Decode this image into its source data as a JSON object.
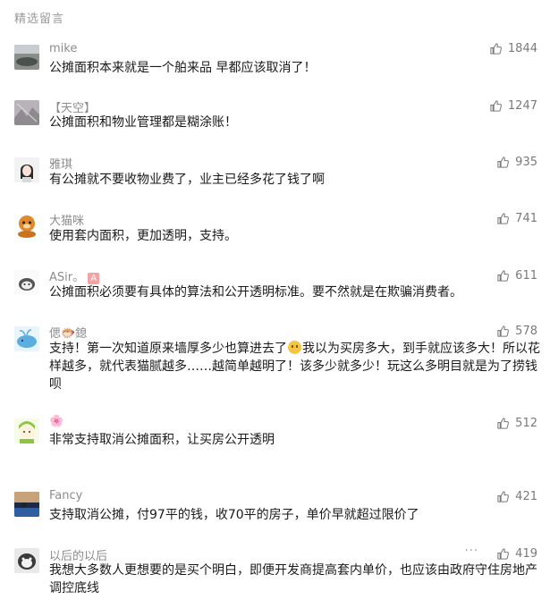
{
  "section": {
    "title": "精选留言"
  },
  "comments": [
    {
      "nickname": "mike",
      "likes": "1844",
      "text": "公摊面积本来就是一个舶来品 早都应该取消了！"
    },
    {
      "nickname": "【天空】",
      "likes": "1247",
      "text": "公摊面积和物业管理都是糊涂账！"
    },
    {
      "nickname": "雅琪",
      "likes": "935",
      "text": "有公摊就不要收物业费了，业主已经多花了钱了啊"
    },
    {
      "nickname": "大猫咪",
      "likes": "741",
      "text": "使用套内面积，更加透明，支持。"
    },
    {
      "nickname": "ASir。",
      "nickname_badge": "A",
      "likes": "611",
      "text": "公摊面积必须要有具体的算法和公开透明标准。要不然就是在欺骗消费者。"
    },
    {
      "nickname": "偲🐡鎴",
      "likes": "578",
      "text_a": "支持！第一次知道原来墙厚多少也算进去了",
      "text_b": "我以为买房多大，到手就应该多大！所以花样越多，就代表猫腻越多……越简单越明了！该多少就多少！玩这么多明目就是为了捞钱呗"
    },
    {
      "nickname": "🌸",
      "likes": "512",
      "text": "非常支持取消公摊面积，让买房公开透明"
    },
    {
      "nickname": "Fancy",
      "likes": "421",
      "text": "支持取消公摊，付97平的钱，收70平的房子，单价早就超过限价了"
    },
    {
      "nickname": "以后的以后",
      "likes": "419",
      "more": "···",
      "text": "我想大多数人更想要的是买个明白，即便开发商提高套内单价，也应该由政府守住房地产调控底线"
    }
  ],
  "colors": {
    "nickname": "#8c8c8c",
    "likes": "#7a7a7a",
    "body_text": "#1a1a1a"
  },
  "icons": {
    "like": "thumbs-up-icon",
    "more": "more-dots-icon"
  }
}
